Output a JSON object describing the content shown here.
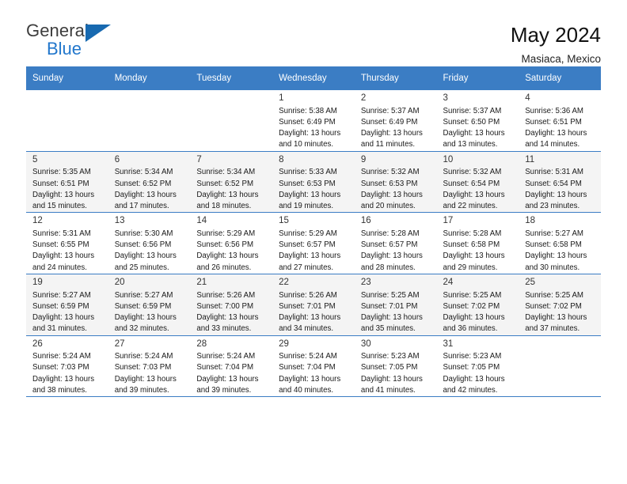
{
  "brand": {
    "name_part1": "General",
    "name_part2": "Blue",
    "accent_color": "#2277cc",
    "triangle_color": "#1769b0"
  },
  "header": {
    "title": "May 2024",
    "subtitle": "Masiaca, Mexico"
  },
  "calendar": {
    "header_bg": "#3b7dc4",
    "weekday_headers": [
      "Sunday",
      "Monday",
      "Tuesday",
      "Wednesday",
      "Thursday",
      "Friday",
      "Saturday"
    ],
    "weeks": [
      {
        "shaded": false,
        "days": [
          {
            "num": "",
            "sunrise": "",
            "sunset": "",
            "daylight1": "",
            "daylight2": "",
            "empty": true
          },
          {
            "num": "",
            "sunrise": "",
            "sunset": "",
            "daylight1": "",
            "daylight2": "",
            "empty": true
          },
          {
            "num": "",
            "sunrise": "",
            "sunset": "",
            "daylight1": "",
            "daylight2": "",
            "empty": true
          },
          {
            "num": "1",
            "sunrise": "Sunrise: 5:38 AM",
            "sunset": "Sunset: 6:49 PM",
            "daylight1": "Daylight: 13 hours",
            "daylight2": "and 10 minutes.",
            "empty": false
          },
          {
            "num": "2",
            "sunrise": "Sunrise: 5:37 AM",
            "sunset": "Sunset: 6:49 PM",
            "daylight1": "Daylight: 13 hours",
            "daylight2": "and 11 minutes.",
            "empty": false
          },
          {
            "num": "3",
            "sunrise": "Sunrise: 5:37 AM",
            "sunset": "Sunset: 6:50 PM",
            "daylight1": "Daylight: 13 hours",
            "daylight2": "and 13 minutes.",
            "empty": false
          },
          {
            "num": "4",
            "sunrise": "Sunrise: 5:36 AM",
            "sunset": "Sunset: 6:51 PM",
            "daylight1": "Daylight: 13 hours",
            "daylight2": "and 14 minutes.",
            "empty": false
          }
        ]
      },
      {
        "shaded": true,
        "days": [
          {
            "num": "5",
            "sunrise": "Sunrise: 5:35 AM",
            "sunset": "Sunset: 6:51 PM",
            "daylight1": "Daylight: 13 hours",
            "daylight2": "and 15 minutes.",
            "empty": false
          },
          {
            "num": "6",
            "sunrise": "Sunrise: 5:34 AM",
            "sunset": "Sunset: 6:52 PM",
            "daylight1": "Daylight: 13 hours",
            "daylight2": "and 17 minutes.",
            "empty": false
          },
          {
            "num": "7",
            "sunrise": "Sunrise: 5:34 AM",
            "sunset": "Sunset: 6:52 PM",
            "daylight1": "Daylight: 13 hours",
            "daylight2": "and 18 minutes.",
            "empty": false
          },
          {
            "num": "8",
            "sunrise": "Sunrise: 5:33 AM",
            "sunset": "Sunset: 6:53 PM",
            "daylight1": "Daylight: 13 hours",
            "daylight2": "and 19 minutes.",
            "empty": false
          },
          {
            "num": "9",
            "sunrise": "Sunrise: 5:32 AM",
            "sunset": "Sunset: 6:53 PM",
            "daylight1": "Daylight: 13 hours",
            "daylight2": "and 20 minutes.",
            "empty": false
          },
          {
            "num": "10",
            "sunrise": "Sunrise: 5:32 AM",
            "sunset": "Sunset: 6:54 PM",
            "daylight1": "Daylight: 13 hours",
            "daylight2": "and 22 minutes.",
            "empty": false
          },
          {
            "num": "11",
            "sunrise": "Sunrise: 5:31 AM",
            "sunset": "Sunset: 6:54 PM",
            "daylight1": "Daylight: 13 hours",
            "daylight2": "and 23 minutes.",
            "empty": false
          }
        ]
      },
      {
        "shaded": false,
        "days": [
          {
            "num": "12",
            "sunrise": "Sunrise: 5:31 AM",
            "sunset": "Sunset: 6:55 PM",
            "daylight1": "Daylight: 13 hours",
            "daylight2": "and 24 minutes.",
            "empty": false
          },
          {
            "num": "13",
            "sunrise": "Sunrise: 5:30 AM",
            "sunset": "Sunset: 6:56 PM",
            "daylight1": "Daylight: 13 hours",
            "daylight2": "and 25 minutes.",
            "empty": false
          },
          {
            "num": "14",
            "sunrise": "Sunrise: 5:29 AM",
            "sunset": "Sunset: 6:56 PM",
            "daylight1": "Daylight: 13 hours",
            "daylight2": "and 26 minutes.",
            "empty": false
          },
          {
            "num": "15",
            "sunrise": "Sunrise: 5:29 AM",
            "sunset": "Sunset: 6:57 PM",
            "daylight1": "Daylight: 13 hours",
            "daylight2": "and 27 minutes.",
            "empty": false
          },
          {
            "num": "16",
            "sunrise": "Sunrise: 5:28 AM",
            "sunset": "Sunset: 6:57 PM",
            "daylight1": "Daylight: 13 hours",
            "daylight2": "and 28 minutes.",
            "empty": false
          },
          {
            "num": "17",
            "sunrise": "Sunrise: 5:28 AM",
            "sunset": "Sunset: 6:58 PM",
            "daylight1": "Daylight: 13 hours",
            "daylight2": "and 29 minutes.",
            "empty": false
          },
          {
            "num": "18",
            "sunrise": "Sunrise: 5:27 AM",
            "sunset": "Sunset: 6:58 PM",
            "daylight1": "Daylight: 13 hours",
            "daylight2": "and 30 minutes.",
            "empty": false
          }
        ]
      },
      {
        "shaded": true,
        "days": [
          {
            "num": "19",
            "sunrise": "Sunrise: 5:27 AM",
            "sunset": "Sunset: 6:59 PM",
            "daylight1": "Daylight: 13 hours",
            "daylight2": "and 31 minutes.",
            "empty": false
          },
          {
            "num": "20",
            "sunrise": "Sunrise: 5:27 AM",
            "sunset": "Sunset: 6:59 PM",
            "daylight1": "Daylight: 13 hours",
            "daylight2": "and 32 minutes.",
            "empty": false
          },
          {
            "num": "21",
            "sunrise": "Sunrise: 5:26 AM",
            "sunset": "Sunset: 7:00 PM",
            "daylight1": "Daylight: 13 hours",
            "daylight2": "and 33 minutes.",
            "empty": false
          },
          {
            "num": "22",
            "sunrise": "Sunrise: 5:26 AM",
            "sunset": "Sunset: 7:01 PM",
            "daylight1": "Daylight: 13 hours",
            "daylight2": "and 34 minutes.",
            "empty": false
          },
          {
            "num": "23",
            "sunrise": "Sunrise: 5:25 AM",
            "sunset": "Sunset: 7:01 PM",
            "daylight1": "Daylight: 13 hours",
            "daylight2": "and 35 minutes.",
            "empty": false
          },
          {
            "num": "24",
            "sunrise": "Sunrise: 5:25 AM",
            "sunset": "Sunset: 7:02 PM",
            "daylight1": "Daylight: 13 hours",
            "daylight2": "and 36 minutes.",
            "empty": false
          },
          {
            "num": "25",
            "sunrise": "Sunrise: 5:25 AM",
            "sunset": "Sunset: 7:02 PM",
            "daylight1": "Daylight: 13 hours",
            "daylight2": "and 37 minutes.",
            "empty": false
          }
        ]
      },
      {
        "shaded": false,
        "days": [
          {
            "num": "26",
            "sunrise": "Sunrise: 5:24 AM",
            "sunset": "Sunset: 7:03 PM",
            "daylight1": "Daylight: 13 hours",
            "daylight2": "and 38 minutes.",
            "empty": false
          },
          {
            "num": "27",
            "sunrise": "Sunrise: 5:24 AM",
            "sunset": "Sunset: 7:03 PM",
            "daylight1": "Daylight: 13 hours",
            "daylight2": "and 39 minutes.",
            "empty": false
          },
          {
            "num": "28",
            "sunrise": "Sunrise: 5:24 AM",
            "sunset": "Sunset: 7:04 PM",
            "daylight1": "Daylight: 13 hours",
            "daylight2": "and 39 minutes.",
            "empty": false
          },
          {
            "num": "29",
            "sunrise": "Sunrise: 5:24 AM",
            "sunset": "Sunset: 7:04 PM",
            "daylight1": "Daylight: 13 hours",
            "daylight2": "and 40 minutes.",
            "empty": false
          },
          {
            "num": "30",
            "sunrise": "Sunrise: 5:23 AM",
            "sunset": "Sunset: 7:05 PM",
            "daylight1": "Daylight: 13 hours",
            "daylight2": "and 41 minutes.",
            "empty": false
          },
          {
            "num": "31",
            "sunrise": "Sunrise: 5:23 AM",
            "sunset": "Sunset: 7:05 PM",
            "daylight1": "Daylight: 13 hours",
            "daylight2": "and 42 minutes.",
            "empty": false
          },
          {
            "num": "",
            "sunrise": "",
            "sunset": "",
            "daylight1": "",
            "daylight2": "",
            "empty": true
          }
        ]
      }
    ]
  }
}
